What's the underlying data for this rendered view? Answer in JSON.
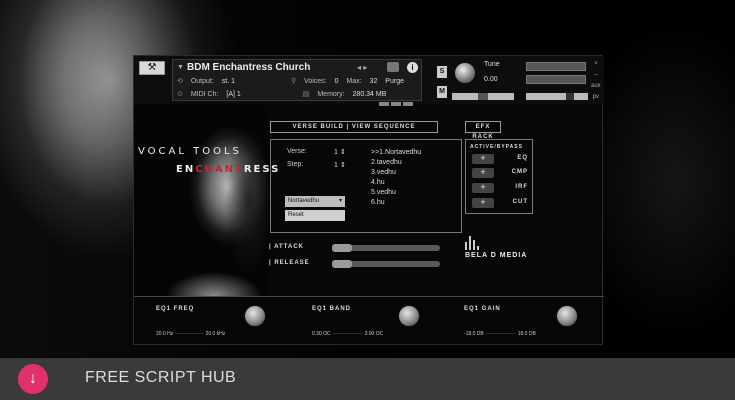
{
  "header": {
    "wrench": "⚒",
    "instrument_name": "BDM Enchantress Church",
    "nav_arrows": "◂ ▸",
    "info": "i",
    "row1": {
      "output_label": "Output:",
      "output_value": "st. 1",
      "voices_label": "Voices:",
      "voices_value": "0",
      "max_label": "Max:",
      "max_value": "32",
      "purge": "Purge"
    },
    "row2": {
      "midi_label": "MIDI Ch:",
      "midi_value": "[A] 1",
      "memory_label": "Memory:",
      "memory_value": "280.34 MB"
    },
    "s": "S",
    "m": "M",
    "tune_label": "Tune",
    "tune_value": "0.00",
    "side": [
      "×",
      "–",
      "aux",
      "pv"
    ]
  },
  "artwork": {
    "vocal_tools": "VOCAL TOOLS",
    "ench_1": "EN",
    "ench_2": "CHANT",
    "ench_3": "RESS"
  },
  "verse": {
    "header": "VERSE BUILD | VIEW SEQUENCE",
    "verse_label": "Verse:",
    "verse_value": "1",
    "step_label": "Step:",
    "step_value": "1",
    "sequence": [
      ">>1.Nortavedhu",
      "2.tavedhu",
      "3.vedhu",
      "4.hu",
      "5.vedhu",
      "6.hu"
    ],
    "dropdown_value": "Nortavedhu",
    "dropdown_caret": "▾",
    "reset": "Reset"
  },
  "efx": {
    "header": "EFX RACK",
    "title": "ACTIVE/BYPASS",
    "items": [
      {
        "toggle": "+",
        "name": "EQ"
      },
      {
        "toggle": "+",
        "name": "CMP"
      },
      {
        "toggle": "+",
        "name": "IRF"
      },
      {
        "toggle": "+",
        "name": "CUT"
      }
    ]
  },
  "envelope": {
    "attack": "| ATTACK",
    "release": "| RELEASE"
  },
  "logo": {
    "text": "BELA D MEDIA"
  },
  "eq": [
    {
      "label": "EQ1 FREQ",
      "min": "20.0 Hz",
      "max": "20.0 kHz"
    },
    {
      "label": "EQ1 BAND",
      "min": "0.30 OC",
      "max": "3.00 OC"
    },
    {
      "label": "EQ1 GAIN",
      "min": "-18.0 DB",
      "max": "18.0 DB"
    }
  ],
  "bottom": {
    "download_icon": "↓",
    "brand": "FREE SCRIPT HUB"
  },
  "colors": {
    "accent_pink": "#e0306e",
    "title_red": "#c8242f"
  }
}
